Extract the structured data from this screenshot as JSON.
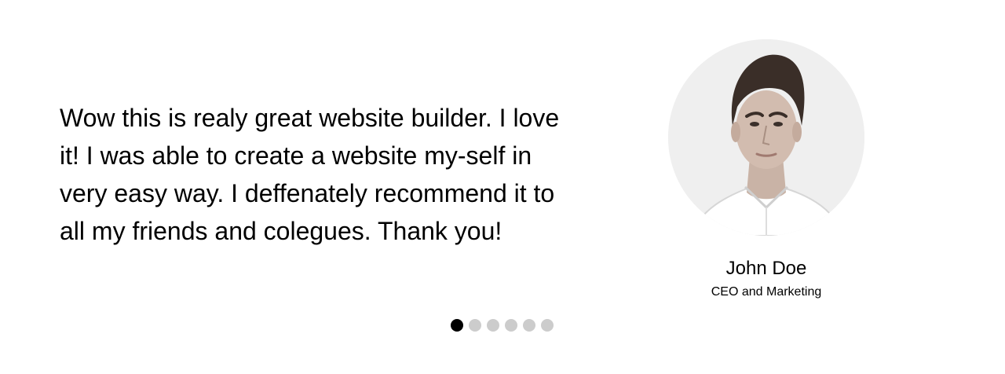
{
  "testimonial": {
    "quote": "Wow this is realy great website builder. I love it! I was able to create a website my-self in very easy way. I deffenately recommend it to all my friends and colegues. Thank you!",
    "author_name": "John Doe",
    "author_role": "CEO and Marketing",
    "avatar_icon": "person-portrait-icon"
  },
  "carousel": {
    "slide_count": 6,
    "active_index": 0,
    "active_color": "#000000",
    "inactive_color": "#cccccc"
  }
}
